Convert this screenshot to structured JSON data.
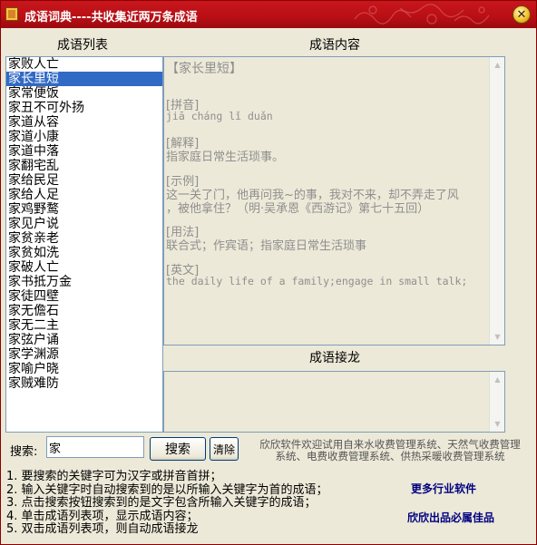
{
  "window": {
    "title": "成语词典----共收集近两万条成语",
    "close_glyph": "✕"
  },
  "labels": {
    "list": "成语列表",
    "content": "成语内容",
    "relay": "成语接龙"
  },
  "idiom_list": [
    "家败人亡",
    "家长里短",
    "家常便饭",
    "家丑不可外扬",
    "家道从容",
    "家道小康",
    "家道中落",
    "家翻宅乱",
    "家给民足",
    "家给人足",
    "家鸡野鹜",
    "家见户说",
    "家贫亲老",
    "家贫如洗",
    "家破人亡",
    "家书抵万金",
    "家徒四壁",
    "家无儋石",
    "家无二主",
    "家弦户诵",
    "家学渊源",
    "家喻户晓",
    "家贼难防"
  ],
  "selected_index": 1,
  "content": {
    "heading": "【家长里短】",
    "pinyin_label": "[拼音]",
    "pinyin": "jiā  cháng  lǐ  duǎn",
    "meaning_label": "[解释]",
    "meaning": "指家庭日常生活琐事。",
    "example_label": "[示例]",
    "example_line1": "这一关了门，他再问我~的事，我对不来，却不弄走了风",
    "example_line2": "，被他拿住？（明·吴承恩《西游记》第七十五回）",
    "usage_label": "[用法]",
    "usage": "联合式；作宾语；指家庭日常生活琐事",
    "english_label": "[英文]",
    "english": "the daily life of a family;engage in small talk;"
  },
  "search": {
    "label": "搜索:",
    "value": "家",
    "button": "搜索",
    "clear": "清除"
  },
  "ad": {
    "line1": "欣欣软件欢迎试用自来水收费管理系统、天然气收费管理",
    "line2": "系统、电费收费管理系统、供热采暖收费管理系统"
  },
  "tips": [
    "1. 要搜索的关键字可为汉字或拼音首拼；",
    "2. 输入关键字时自动搜索到的是以所输入关键字为首的成语；",
    "3. 点击搜索按钮搜索到的是文字包含所输入关键字的成语；",
    "4. 单击成语列表项，显示成语内容；",
    "5. 双击成语列表项，则自动成语接龙"
  ],
  "links": {
    "more": "更多行业软件",
    "brand": "欣欣出品必属佳品"
  },
  "colors": {
    "titlebar": "#c8161d",
    "selection": "#316ac5",
    "link": "#000080"
  }
}
